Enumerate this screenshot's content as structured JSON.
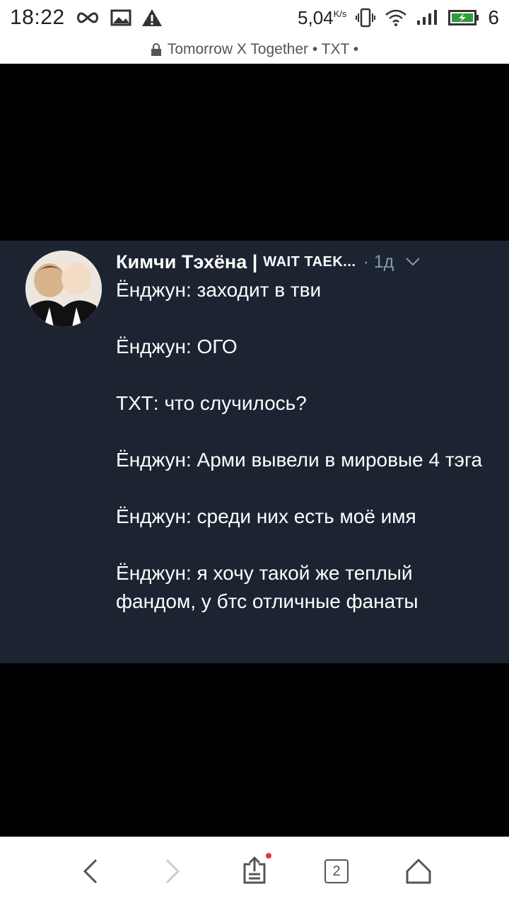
{
  "status_bar": {
    "time": "18:22",
    "net_speed": "5,04",
    "net_speed_unit": "K/s",
    "battery_level": "6"
  },
  "url_bar": {
    "title": "Tomorrow X Together • TXT •"
  },
  "tweet": {
    "author_name": "Кимчи Тэхёна |",
    "author_tag": "WAIT TAEK...",
    "time": "· 1д",
    "lines": [
      "Ёнджун: заходит в тви",
      "Ёнджун: ОГО",
      "ТХТ: что случилось?",
      "Ёнджун: Арми вывели в мировые 4 тэга",
      "Ёнджун: среди них есть моё имя",
      "Ёнджун: я хочу такой же теплый фандом, у бтс отличные фанаты"
    ]
  },
  "bottom_nav": {
    "tab_count": "2"
  },
  "colors": {
    "tweet_bg": "#1c2431",
    "muted": "#8899a6",
    "notification_dot": "#e53935"
  }
}
